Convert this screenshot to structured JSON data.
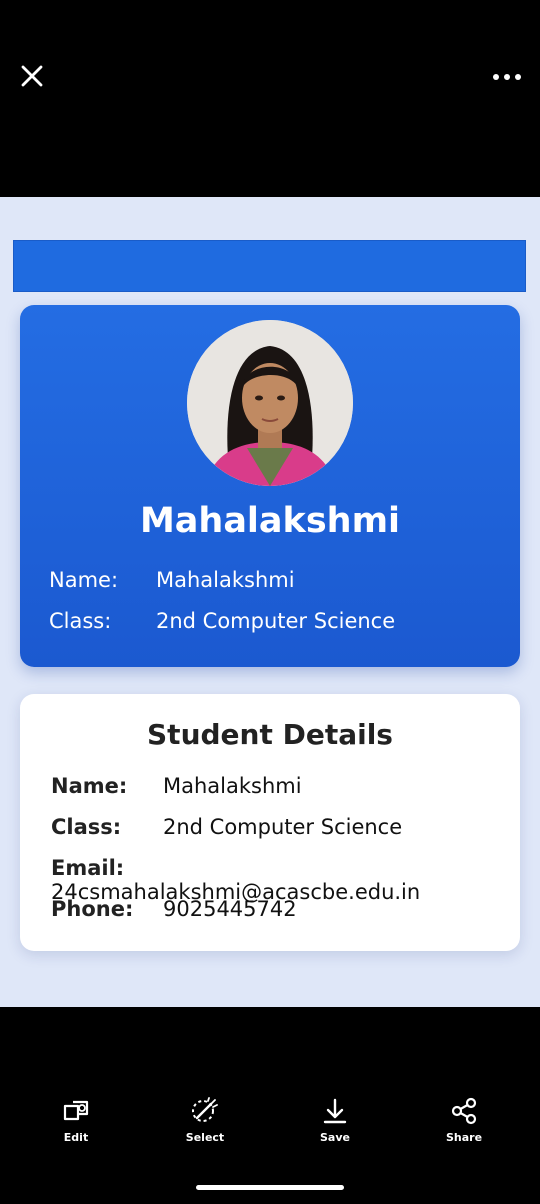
{
  "header": {
    "close_icon": "close-icon",
    "more_icon": "more-options-icon"
  },
  "profile_card": {
    "name_heading": "Mahalakshmi",
    "rows": [
      {
        "label": "Name:",
        "value": "Mahalakshmi"
      },
      {
        "label": "Class:",
        "value": "2nd Computer Science"
      }
    ]
  },
  "details_card": {
    "title": "Student Details",
    "rows": [
      {
        "label": "Name:",
        "value": "Mahalakshmi"
      },
      {
        "label": "Class:",
        "value": "2nd Computer Science"
      },
      {
        "label": "Email:",
        "value": "24csmahalakshmi@acascbe.edu.in"
      },
      {
        "label": "Phone:",
        "value": "9025445742"
      }
    ]
  },
  "toolbar": {
    "items": [
      {
        "label": "Edit",
        "icon": "edit-icon"
      },
      {
        "label": "Select",
        "icon": "select-icon"
      },
      {
        "label": "Save",
        "icon": "save-icon"
      },
      {
        "label": "Share",
        "icon": "share-icon"
      }
    ]
  },
  "colors": {
    "card_blue": "#1f6be0",
    "viewer_bg": "#dfe7f8",
    "bar_bg": "#000000"
  }
}
